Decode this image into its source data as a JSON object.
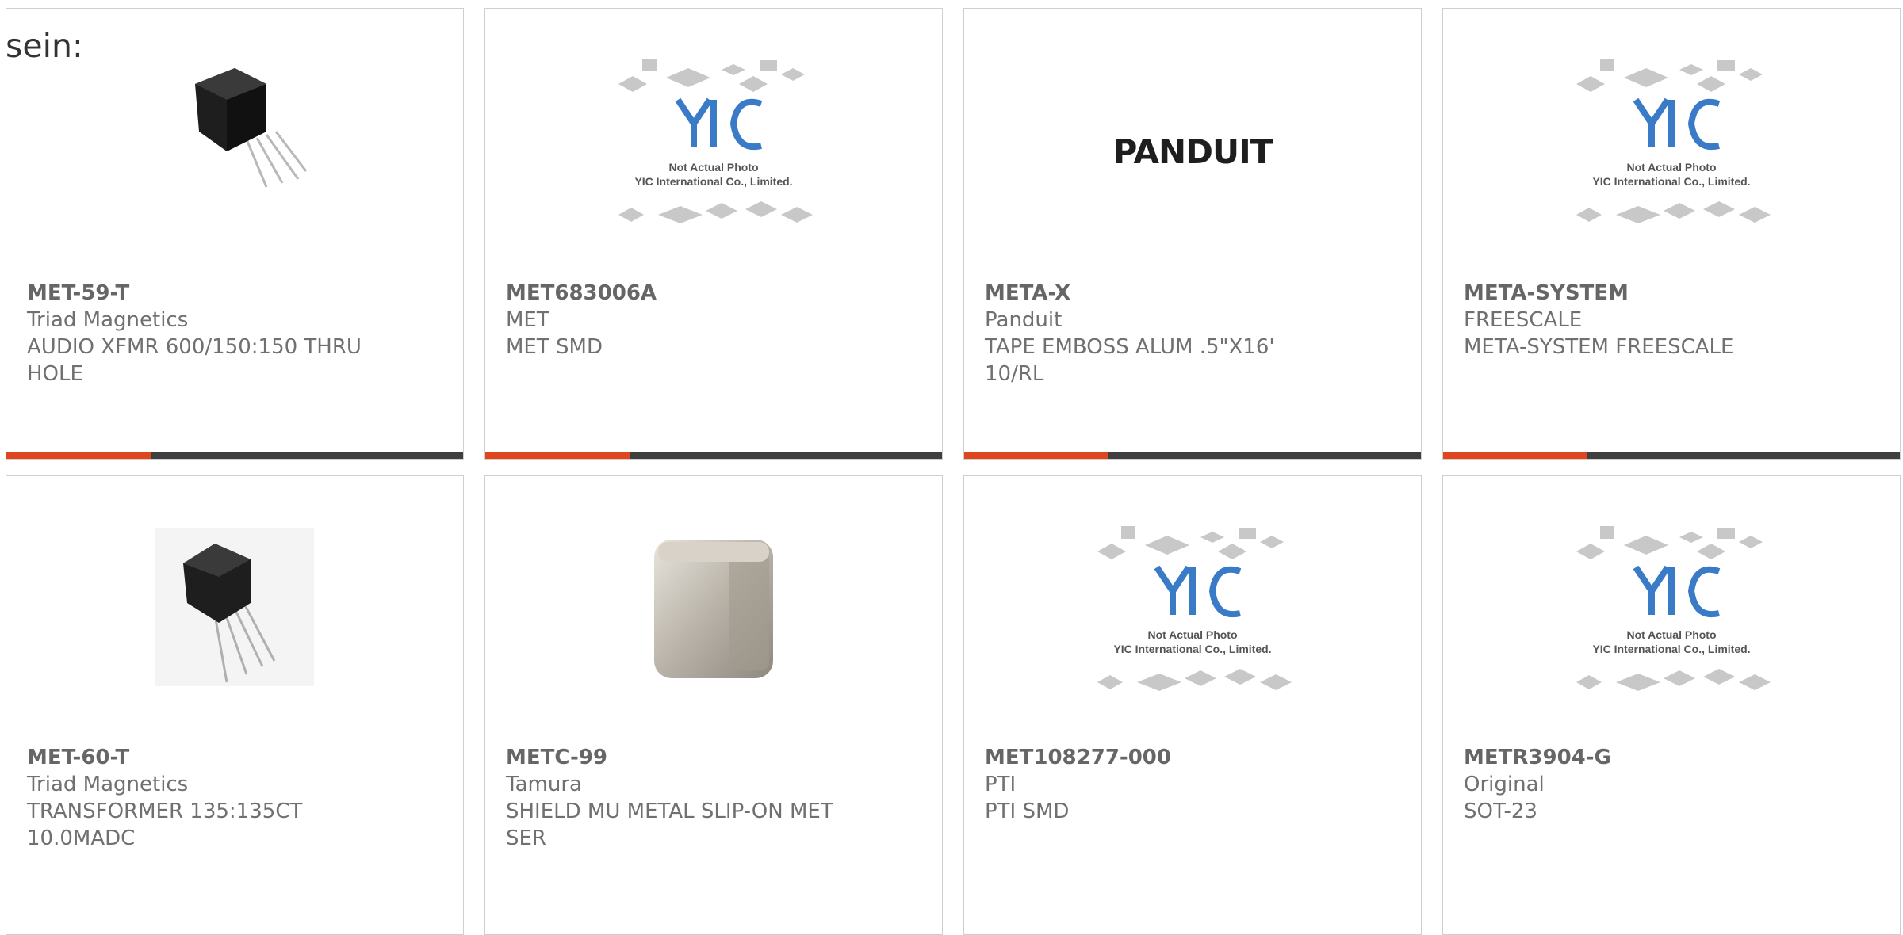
{
  "intro_text": "sein:",
  "accent_color": "#e0461d",
  "bar_color": "#3f3f3f",
  "products": [
    {
      "part": "MET-59-T",
      "manufacturer": "Triad Magnetics",
      "description": "AUDIO XFMR 600/150:150 THRU HOLE",
      "image": "transformer-image"
    },
    {
      "part": "MET683006A",
      "manufacturer": "MET",
      "description": "MET SMD",
      "image": "placeholder-image",
      "placeholder_line1": "Not Actual Photo",
      "placeholder_line2": "YIC International Co., Limited."
    },
    {
      "part": "META-X",
      "manufacturer": "Panduit",
      "description": "TAPE EMBOSS ALUM .5\"X16' 10/RL",
      "image": "brand-logo",
      "logo_text": "PANDUIT"
    },
    {
      "part": "META-SYSTEM",
      "manufacturer": "FREESCALE",
      "description": "META-SYSTEM FREESCALE",
      "image": "placeholder-image",
      "placeholder_line1": "Not Actual Photo",
      "placeholder_line2": "YIC International Co., Limited."
    },
    {
      "part": "MET-60-T",
      "manufacturer": "Triad Magnetics",
      "description": "TRANSFORMER 135:135CT 10.0MADC",
      "image": "transformer-image"
    },
    {
      "part": "METC-99",
      "manufacturer": "Tamura",
      "description": "SHIELD MU METAL SLIP-ON MET SER",
      "image": "metal-shield-image"
    },
    {
      "part": "MET108277-000",
      "manufacturer": "PTI",
      "description": "PTI SMD",
      "image": "placeholder-image",
      "placeholder_line1": "Not Actual Photo",
      "placeholder_line2": "YIC International Co., Limited."
    },
    {
      "part": "METR3904-G",
      "manufacturer": "Original",
      "description": "SOT-23",
      "image": "placeholder-image",
      "placeholder_line1": "Not Actual Photo",
      "placeholder_line2": "YIC International Co., Limited."
    }
  ]
}
